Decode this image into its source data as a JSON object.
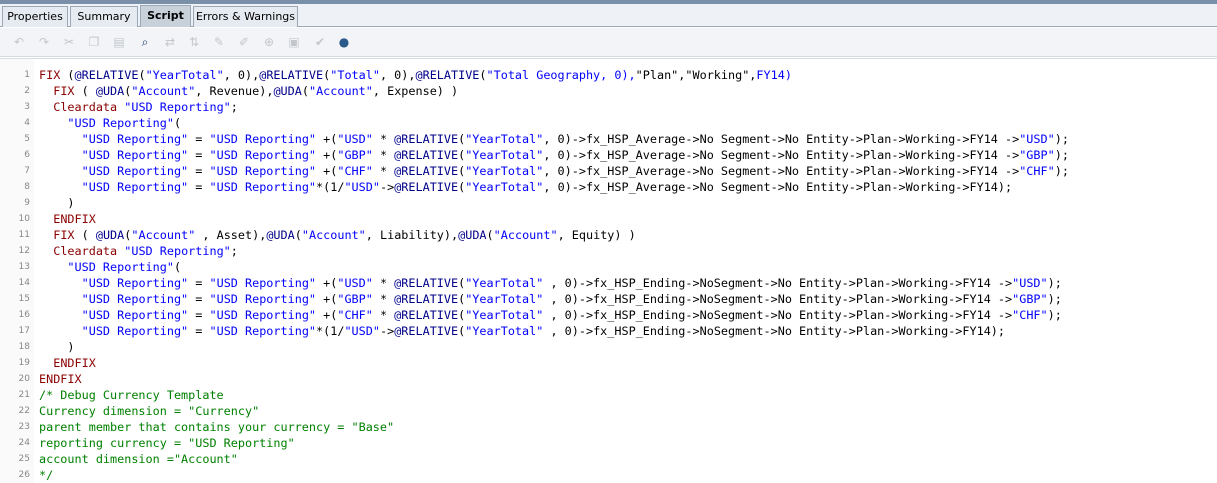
{
  "tabs": [
    {
      "label": "Properties",
      "active": false
    },
    {
      "label": "Summary",
      "active": false
    },
    {
      "label": "Script",
      "active": true
    },
    {
      "label": "Errors & Warnings",
      "active": false
    }
  ],
  "toolbar": {
    "icons": [
      "undo-icon",
      "redo-icon",
      "cut-icon",
      "copy-icon",
      "paste-icon",
      "find-icon",
      "replace-icon",
      "sort-icon",
      "comment-icon",
      "uncomment-icon",
      "insert-icon",
      "validate-icon",
      "format-icon",
      "check-icon",
      "chat-icon"
    ]
  },
  "colors": {
    "keyword": "#8b0000",
    "function": "#00008b",
    "string": "#0000ff",
    "text": "#000000",
    "comment": "#008000"
  },
  "script": {
    "lines": [
      [
        [
          "kw",
          "FIX"
        ],
        [
          "txt",
          " ("
        ],
        [
          "fn",
          "@RELATIVE"
        ],
        [
          "txt",
          "("
        ],
        [
          "str",
          "\"YearTotal\""
        ],
        [
          "txt",
          ", 0),"
        ],
        [
          "fn",
          "@RELATIVE"
        ],
        [
          "txt",
          "("
        ],
        [
          "str",
          "\"Total\""
        ],
        [
          "txt",
          ", 0),"
        ],
        [
          "fn",
          "@RELATIVE"
        ],
        [
          "txt",
          "("
        ],
        [
          "str",
          "\"Total Geography, 0),"
        ],
        [
          "txt",
          "\"Plan\",\"Working\","
        ],
        [
          "str",
          "FY14)"
        ]
      ],
      [
        [
          "txt",
          "  "
        ],
        [
          "kw",
          "FIX"
        ],
        [
          "txt",
          " ( "
        ],
        [
          "fn",
          "@UDA"
        ],
        [
          "txt",
          "("
        ],
        [
          "str",
          "\"Account\""
        ],
        [
          "txt",
          ", Revenue),"
        ],
        [
          "fn",
          "@UDA"
        ],
        [
          "txt",
          "("
        ],
        [
          "str",
          "\"Account\""
        ],
        [
          "txt",
          ", Expense) )"
        ]
      ],
      [
        [
          "txt",
          "  "
        ],
        [
          "kw",
          "Cleardata"
        ],
        [
          "txt",
          " "
        ],
        [
          "str",
          "\"USD Reporting\""
        ],
        [
          "txt",
          ";"
        ]
      ],
      [
        [
          "txt",
          "    "
        ],
        [
          "str",
          "\"USD Reporting\""
        ],
        [
          "txt",
          "("
        ]
      ],
      [
        [
          "txt",
          "      "
        ],
        [
          "str",
          "\"USD Reporting\""
        ],
        [
          "txt",
          " = "
        ],
        [
          "str",
          "\"USD Reporting\""
        ],
        [
          "txt",
          " +("
        ],
        [
          "str",
          "\"USD\""
        ],
        [
          "txt",
          " * "
        ],
        [
          "fn",
          "@RELATIVE"
        ],
        [
          "txt",
          "("
        ],
        [
          "str",
          "\"YearTotal\""
        ],
        [
          "txt",
          ", 0)->fx_HSP_Average->No Segment->No Entity->Plan->Working->FY14 ->"
        ],
        [
          "str",
          "\"USD\""
        ],
        [
          "txt",
          ");"
        ]
      ],
      [
        [
          "txt",
          "      "
        ],
        [
          "str",
          "\"USD Reporting\""
        ],
        [
          "txt",
          " = "
        ],
        [
          "str",
          "\"USD Reporting\""
        ],
        [
          "txt",
          " +("
        ],
        [
          "str",
          "\"GBP\""
        ],
        [
          "txt",
          " * "
        ],
        [
          "fn",
          "@RELATIVE"
        ],
        [
          "txt",
          "("
        ],
        [
          "str",
          "\"YearTotal\""
        ],
        [
          "txt",
          ", 0)->fx_HSP_Average->No Segment->No Entity->Plan->Working->FY14 ->"
        ],
        [
          "str",
          "\"GBP\""
        ],
        [
          "txt",
          ");"
        ]
      ],
      [
        [
          "txt",
          "      "
        ],
        [
          "str",
          "\"USD Reporting\""
        ],
        [
          "txt",
          " = "
        ],
        [
          "str",
          "\"USD Reporting\""
        ],
        [
          "txt",
          " +("
        ],
        [
          "str",
          "\"CHF\""
        ],
        [
          "txt",
          " * "
        ],
        [
          "fn",
          "@RELATIVE"
        ],
        [
          "txt",
          "("
        ],
        [
          "str",
          "\"YearTotal\""
        ],
        [
          "txt",
          ", 0)->fx_HSP_Average->No Segment->No Entity->Plan->Working->FY14 ->"
        ],
        [
          "str",
          "\"CHF\""
        ],
        [
          "txt",
          ");"
        ]
      ],
      [
        [
          "txt",
          "      "
        ],
        [
          "str",
          "\"USD Reporting\""
        ],
        [
          "txt",
          " = "
        ],
        [
          "str",
          "\"USD Reporting\""
        ],
        [
          "txt",
          "*(1/"
        ],
        [
          "str",
          "\"USD\""
        ],
        [
          "txt",
          "->"
        ],
        [
          "fn",
          "@RELATIVE"
        ],
        [
          "txt",
          "("
        ],
        [
          "str",
          "\"YearTotal\""
        ],
        [
          "txt",
          ", 0)->fx_HSP_Average->No Segment->No Entity->Plan->Working->FY14);"
        ]
      ],
      [
        [
          "txt",
          "    )"
        ]
      ],
      [
        [
          "txt",
          "  "
        ],
        [
          "kw",
          "ENDFIX"
        ]
      ],
      [
        [
          "txt",
          "  "
        ],
        [
          "kw",
          "FIX"
        ],
        [
          "txt",
          " ( "
        ],
        [
          "fn",
          "@UDA"
        ],
        [
          "txt",
          "("
        ],
        [
          "str",
          "\"Account\""
        ],
        [
          "txt",
          " , Asset),"
        ],
        [
          "fn",
          "@UDA"
        ],
        [
          "txt",
          "("
        ],
        [
          "str",
          "\"Account\""
        ],
        [
          "txt",
          ", Liability),"
        ],
        [
          "fn",
          "@UDA"
        ],
        [
          "txt",
          "("
        ],
        [
          "str",
          "\"Account\""
        ],
        [
          "txt",
          ", Equity) )"
        ]
      ],
      [
        [
          "txt",
          "  "
        ],
        [
          "kw",
          "Cleardata"
        ],
        [
          "txt",
          " "
        ],
        [
          "str",
          "\"USD Reporting\""
        ],
        [
          "txt",
          ";"
        ]
      ],
      [
        [
          "txt",
          "    "
        ],
        [
          "str",
          "\"USD Reporting\""
        ],
        [
          "txt",
          "("
        ]
      ],
      [
        [
          "txt",
          "      "
        ],
        [
          "str",
          "\"USD Reporting\""
        ],
        [
          "txt",
          " = "
        ],
        [
          "str",
          "\"USD Reporting\""
        ],
        [
          "txt",
          " +("
        ],
        [
          "str",
          "\"USD\""
        ],
        [
          "txt",
          " * "
        ],
        [
          "fn",
          "@RELATIVE"
        ],
        [
          "txt",
          "("
        ],
        [
          "str",
          "\"YearTotal\""
        ],
        [
          "txt",
          " , 0)->fx_HSP_Ending->NoSegment->No Entity->Plan->Working->FY14 ->"
        ],
        [
          "str",
          "\"USD\""
        ],
        [
          "txt",
          ");"
        ]
      ],
      [
        [
          "txt",
          "      "
        ],
        [
          "str",
          "\"USD Reporting\""
        ],
        [
          "txt",
          " = "
        ],
        [
          "str",
          "\"USD Reporting\""
        ],
        [
          "txt",
          " +("
        ],
        [
          "str",
          "\"GBP\""
        ],
        [
          "txt",
          " * "
        ],
        [
          "fn",
          "@RELATIVE"
        ],
        [
          "txt",
          "("
        ],
        [
          "str",
          "\"YearTotal\""
        ],
        [
          "txt",
          " , 0)->fx_HSP_Ending->NoSegment->No Entity->Plan->Working->FY14 ->"
        ],
        [
          "str",
          "\"GBP\""
        ],
        [
          "txt",
          ");"
        ]
      ],
      [
        [
          "txt",
          "      "
        ],
        [
          "str",
          "\"USD Reporting\""
        ],
        [
          "txt",
          " = "
        ],
        [
          "str",
          "\"USD Reporting\""
        ],
        [
          "txt",
          " +("
        ],
        [
          "str",
          "\"CHF\""
        ],
        [
          "txt",
          " * "
        ],
        [
          "fn",
          "@RELATIVE"
        ],
        [
          "txt",
          "("
        ],
        [
          "str",
          "\"YearTotal\""
        ],
        [
          "txt",
          " , 0)->fx_HSP_Ending->NoSegment->No Entity->Plan->Working->FY14 ->"
        ],
        [
          "str",
          "\"CHF\""
        ],
        [
          "txt",
          ");"
        ]
      ],
      [
        [
          "txt",
          "      "
        ],
        [
          "str",
          "\"USD Reporting\""
        ],
        [
          "txt",
          " = "
        ],
        [
          "str",
          "\"USD Reporting\""
        ],
        [
          "txt",
          "*(1/"
        ],
        [
          "str",
          "\"USD\""
        ],
        [
          "txt",
          "->"
        ],
        [
          "fn",
          "@RELATIVE"
        ],
        [
          "txt",
          "("
        ],
        [
          "str",
          "\"YearTotal\""
        ],
        [
          "txt",
          " , 0)->fx_HSP_Ending->NoSegment->No Entity->Plan->Working->FY14);"
        ]
      ],
      [
        [
          "txt",
          "    )"
        ]
      ],
      [
        [
          "txt",
          "  "
        ],
        [
          "kw",
          "ENDFIX"
        ]
      ],
      [
        [
          "kw",
          "ENDFIX"
        ]
      ],
      [
        [
          "cmt",
          "/* Debug Currency Template"
        ]
      ],
      [
        [
          "cmt",
          "Currency dimension = \"Currency\""
        ]
      ],
      [
        [
          "cmt",
          "parent member that contains your currency = \"Base\""
        ]
      ],
      [
        [
          "cmt",
          "reporting currency = \"USD Reporting\""
        ]
      ],
      [
        [
          "cmt",
          "account dimension =\"Account\""
        ]
      ],
      [
        [
          "cmt",
          "*/"
        ]
      ]
    ]
  }
}
